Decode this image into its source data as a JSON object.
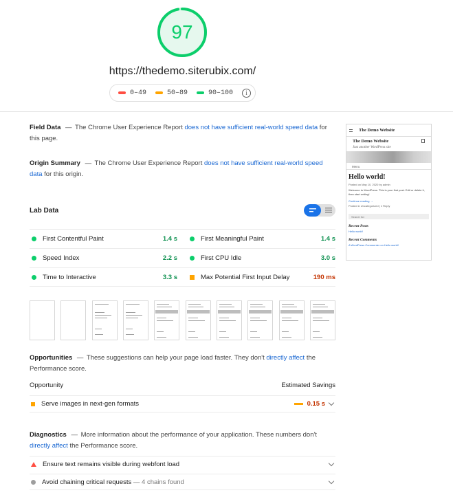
{
  "score": {
    "value": "97",
    "fraction": 0.97,
    "color": "#0cce6b"
  },
  "url": "https://thedemo.siterubix.com/",
  "legend": [
    {
      "range": "0–49",
      "color": "#ff4e42"
    },
    {
      "range": "50–89",
      "color": "#ffa400"
    },
    {
      "range": "90–100",
      "color": "#0cce6b"
    }
  ],
  "field_data": {
    "title": "Field Data",
    "dash": "—",
    "prefix": "The Chrome User Experience Report",
    "link": "does not have sufficient real-world speed data",
    "suffix": "for this page."
  },
  "origin_summary": {
    "title": "Origin Summary",
    "dash": "—",
    "prefix": "The Chrome User Experience Report",
    "link": "does not have sufficient real-world speed data",
    "suffix": "for this origin."
  },
  "lab_data": {
    "title": "Lab Data",
    "metrics": [
      {
        "label": "First Contentful Paint",
        "value": "1.4 s",
        "status": "pass"
      },
      {
        "label": "First Meaningful Paint",
        "value": "1.4 s",
        "status": "pass"
      },
      {
        "label": "Speed Index",
        "value": "2.2 s",
        "status": "pass"
      },
      {
        "label": "First CPU Idle",
        "value": "3.0 s",
        "status": "pass"
      },
      {
        "label": "Time to Interactive",
        "value": "3.3 s",
        "status": "pass"
      },
      {
        "label": "Max Potential First Input Delay",
        "value": "190 ms",
        "status": "average"
      }
    ]
  },
  "opportunities": {
    "title": "Opportunities",
    "dash": "—",
    "prefix": "These suggestions can help your page load faster. They don't",
    "link": "directly affect",
    "suffix": "the Performance score.",
    "col_left": "Opportunity",
    "col_right": "Estimated Savings",
    "items": [
      {
        "label": "Serve images in next-gen formats",
        "value": "0.15 s"
      }
    ]
  },
  "diagnostics": {
    "title": "Diagnostics",
    "dash": "—",
    "prefix": "More information about the performance of your application. These numbers don't",
    "link": "directly affect",
    "suffix": "the Performance score.",
    "items": [
      {
        "label": "Ensure text remains visible during webfont load",
        "detail": ""
      },
      {
        "label": "Avoid chaining critical requests",
        "detail": "— 4 chains found"
      }
    ]
  },
  "screenshot": {
    "site_title": "The Demo Website",
    "tagline": "Just another WordPress site",
    "nav": "Menu",
    "post_title": "Hello world!",
    "meta": "Posted on May 10, 2020 by admin",
    "text": "Welcome to WordPress. This is your first post. Edit or delete it, then start writing!",
    "more": "Continue reading →",
    "posted_in": "Posted in Uncategorized | 1 Reply",
    "search": "Search for:",
    "recent_posts": "Recent Posts",
    "recent_post_item": "Hello world!",
    "recent_comments": "Recent Comments",
    "recent_comment_item": "A WordPress Commenter on Hello world!"
  }
}
